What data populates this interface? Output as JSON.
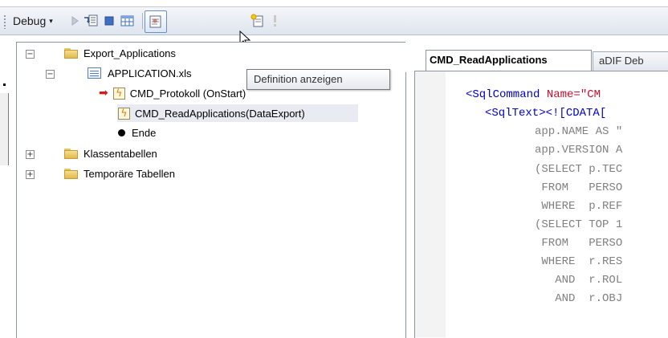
{
  "toolbar": {
    "debug_label": "Debug",
    "debug_arrow": "▾"
  },
  "tree": {
    "root": {
      "label": "Export_Applications",
      "expander": "−"
    },
    "application": {
      "label": "APPLICATION.xls",
      "expander": "−"
    },
    "cmd_protokoll": {
      "label": "CMD_Protokoll (OnStart)"
    },
    "cmd_read": {
      "label": "CMD_ReadApplications(DataExport)"
    },
    "ende": {
      "label": "Ende"
    },
    "klassentabellen": {
      "label": "Klassentabellen",
      "expander": "+"
    },
    "temporaere": {
      "label": "Temporäre Tabellen",
      "expander": "+"
    }
  },
  "tooltip": {
    "text": "Definition anzeigen"
  },
  "tabs": [
    {
      "label": "CMD_ReadApplications",
      "active": true
    },
    {
      "label": "aDIF Deb",
      "active": false
    }
  ],
  "code": {
    "line1a": "<SqlCommand ",
    "line1b": "Name=\"CM",
    "line2a": "<SqlText><![CDATA[",
    "lines": [
      "app.NAME AS \"",
      "app.VERSION A",
      "(SELECT p.TEC",
      " FROM   PERSO",
      " WHERE  p.REF",
      "(SELECT TOP 1",
      " FROM   PERSO",
      " WHERE  r.RES",
      "   AND  r.ROL",
      "   AND  r.OBJ"
    ]
  },
  "colors": {
    "xml_tag": "#0000cc",
    "xml_attr": "#c8102e",
    "sql_text": "#808080",
    "breakpoint_arrow": "#d61a1a"
  }
}
